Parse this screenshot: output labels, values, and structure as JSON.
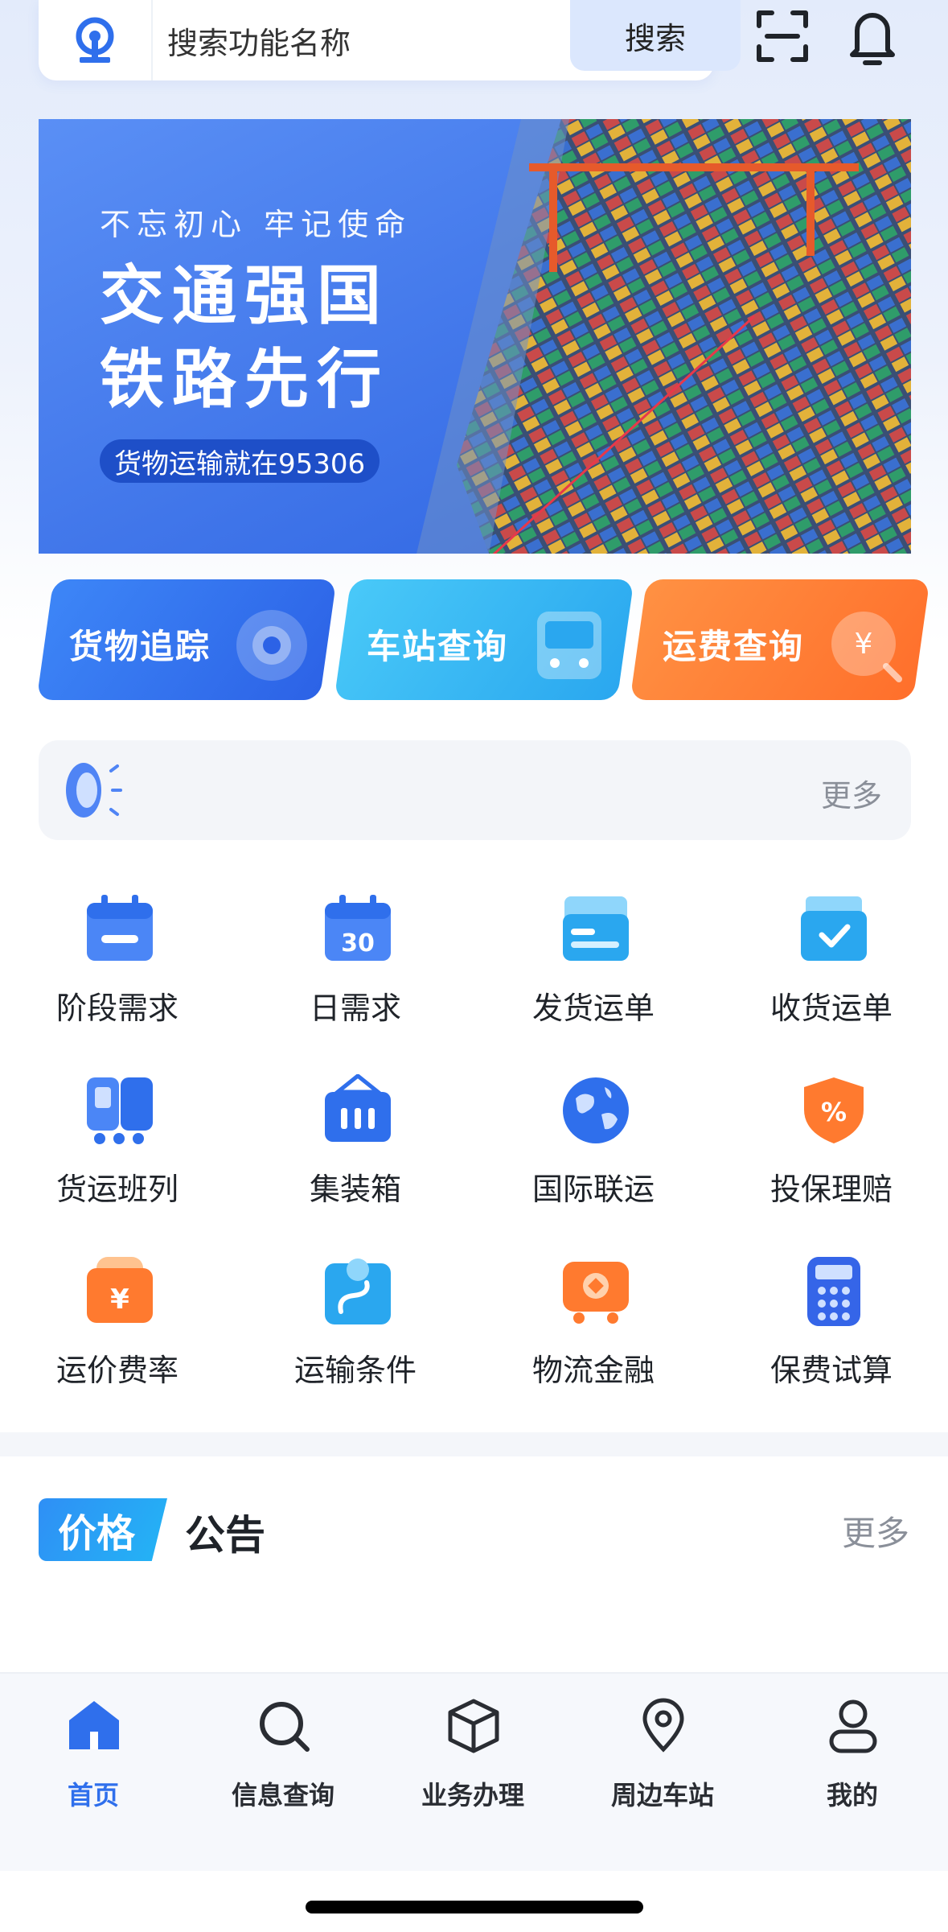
{
  "search": {
    "placeholder": "搜索功能名称",
    "button_label": "搜索"
  },
  "banner": {
    "motto": "不忘初心 牢记使命",
    "headline_line1": "交通强国",
    "headline_line2": "铁路先行",
    "pill": "货物运输就在95306"
  },
  "quick_actions": [
    {
      "label": "货物追踪",
      "icon": "target-icon"
    },
    {
      "label": "车站查询",
      "icon": "train-icon"
    },
    {
      "label": "运费查询",
      "icon": "yuan-search-icon"
    }
  ],
  "notice": {
    "icon": "speaker-icon",
    "more_label": "更多"
  },
  "services": [
    {
      "label": "阶段需求",
      "icon": "calendar-icon"
    },
    {
      "label": "日需求",
      "icon": "calendar-30-icon"
    },
    {
      "label": "发货运单",
      "icon": "waybill-send-icon"
    },
    {
      "label": "收货运单",
      "icon": "waybill-receive-icon"
    },
    {
      "label": "货运班列",
      "icon": "freight-train-icon"
    },
    {
      "label": "集装箱",
      "icon": "container-icon"
    },
    {
      "label": "国际联运",
      "icon": "globe-icon"
    },
    {
      "label": "投保理赔",
      "icon": "insurance-shield-icon"
    },
    {
      "label": "运价费率",
      "icon": "rate-wallet-icon"
    },
    {
      "label": "运输条件",
      "icon": "route-map-icon"
    },
    {
      "label": "物流金融",
      "icon": "finance-truck-icon"
    },
    {
      "label": "保费试算",
      "icon": "calculator-icon"
    }
  ],
  "announcement": {
    "tag": "价格",
    "title": "公告",
    "more_label": "更多"
  },
  "tabbar": [
    {
      "label": "首页",
      "icon": "home-icon",
      "active": true
    },
    {
      "label": "信息查询",
      "icon": "search-icon",
      "active": false
    },
    {
      "label": "业务办理",
      "icon": "package-icon",
      "active": false
    },
    {
      "label": "周边车站",
      "icon": "location-pin-icon",
      "active": false
    },
    {
      "label": "我的",
      "icon": "user-icon",
      "active": false
    }
  ],
  "colors": {
    "accent": "#2f6fec",
    "quick_blue": "#2c62e6",
    "quick_cyan": "#2aa7ef",
    "quick_orange": "#ff6f2b"
  }
}
